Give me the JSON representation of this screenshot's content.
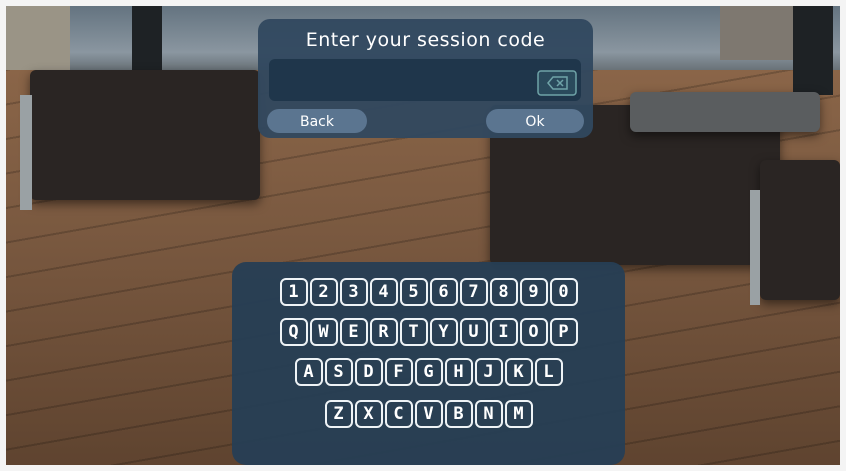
{
  "dialog": {
    "title": "Enter your session code",
    "input_value": "",
    "backspace_icon": "backspace-icon",
    "back_label": "Back",
    "ok_label": "Ok"
  },
  "keyboard": {
    "rows": [
      [
        "1",
        "2",
        "3",
        "4",
        "5",
        "6",
        "7",
        "8",
        "9",
        "0"
      ],
      [
        "Q",
        "W",
        "E",
        "R",
        "T",
        "Y",
        "U",
        "I",
        "O",
        "P"
      ],
      [
        "A",
        "S",
        "D",
        "F",
        "G",
        "H",
        "J",
        "K",
        "L"
      ],
      [
        "Z",
        "X",
        "C",
        "V",
        "B",
        "N",
        "M"
      ]
    ]
  },
  "colors": {
    "panel": "#30485f",
    "button": "#5b7590",
    "input": "#1f364b",
    "key_border": "#eef3f6"
  }
}
